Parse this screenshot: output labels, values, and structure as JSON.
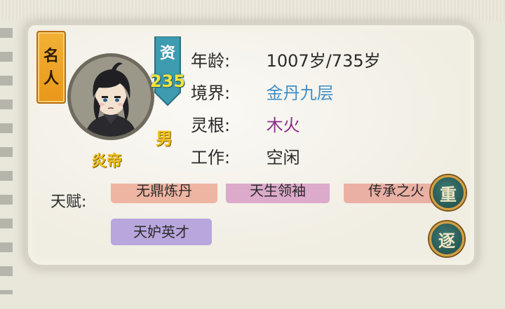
{
  "badge": {
    "line1": "名",
    "line2": "人"
  },
  "aptitude": {
    "label": "资",
    "value": "235"
  },
  "character": {
    "name": "炎帝",
    "gender": "男"
  },
  "info": {
    "age": {
      "label": "年龄:",
      "value": "1007岁/735岁",
      "color": "#2a2a2a"
    },
    "realm": {
      "label": "境界:",
      "value": "金丹九层",
      "color": "#3f8fc9"
    },
    "root": {
      "label": "灵根:",
      "value": "木火",
      "color": "#8a2e8a"
    },
    "job": {
      "label": "工作:",
      "value": "空闲",
      "color": "#2a2a2a"
    }
  },
  "talents": {
    "label": "天赋:",
    "items": [
      "无鼎炼丹",
      "天生领袖",
      "传承之火",
      "天妒英才"
    ]
  },
  "buttons": {
    "reroll": "重",
    "expel": "逐"
  },
  "colors": {
    "badge": "#e89719",
    "aptitude_tag": "#3e9bb0",
    "button_bg": "#2b5f5a",
    "button_rim": "#d5a043"
  }
}
